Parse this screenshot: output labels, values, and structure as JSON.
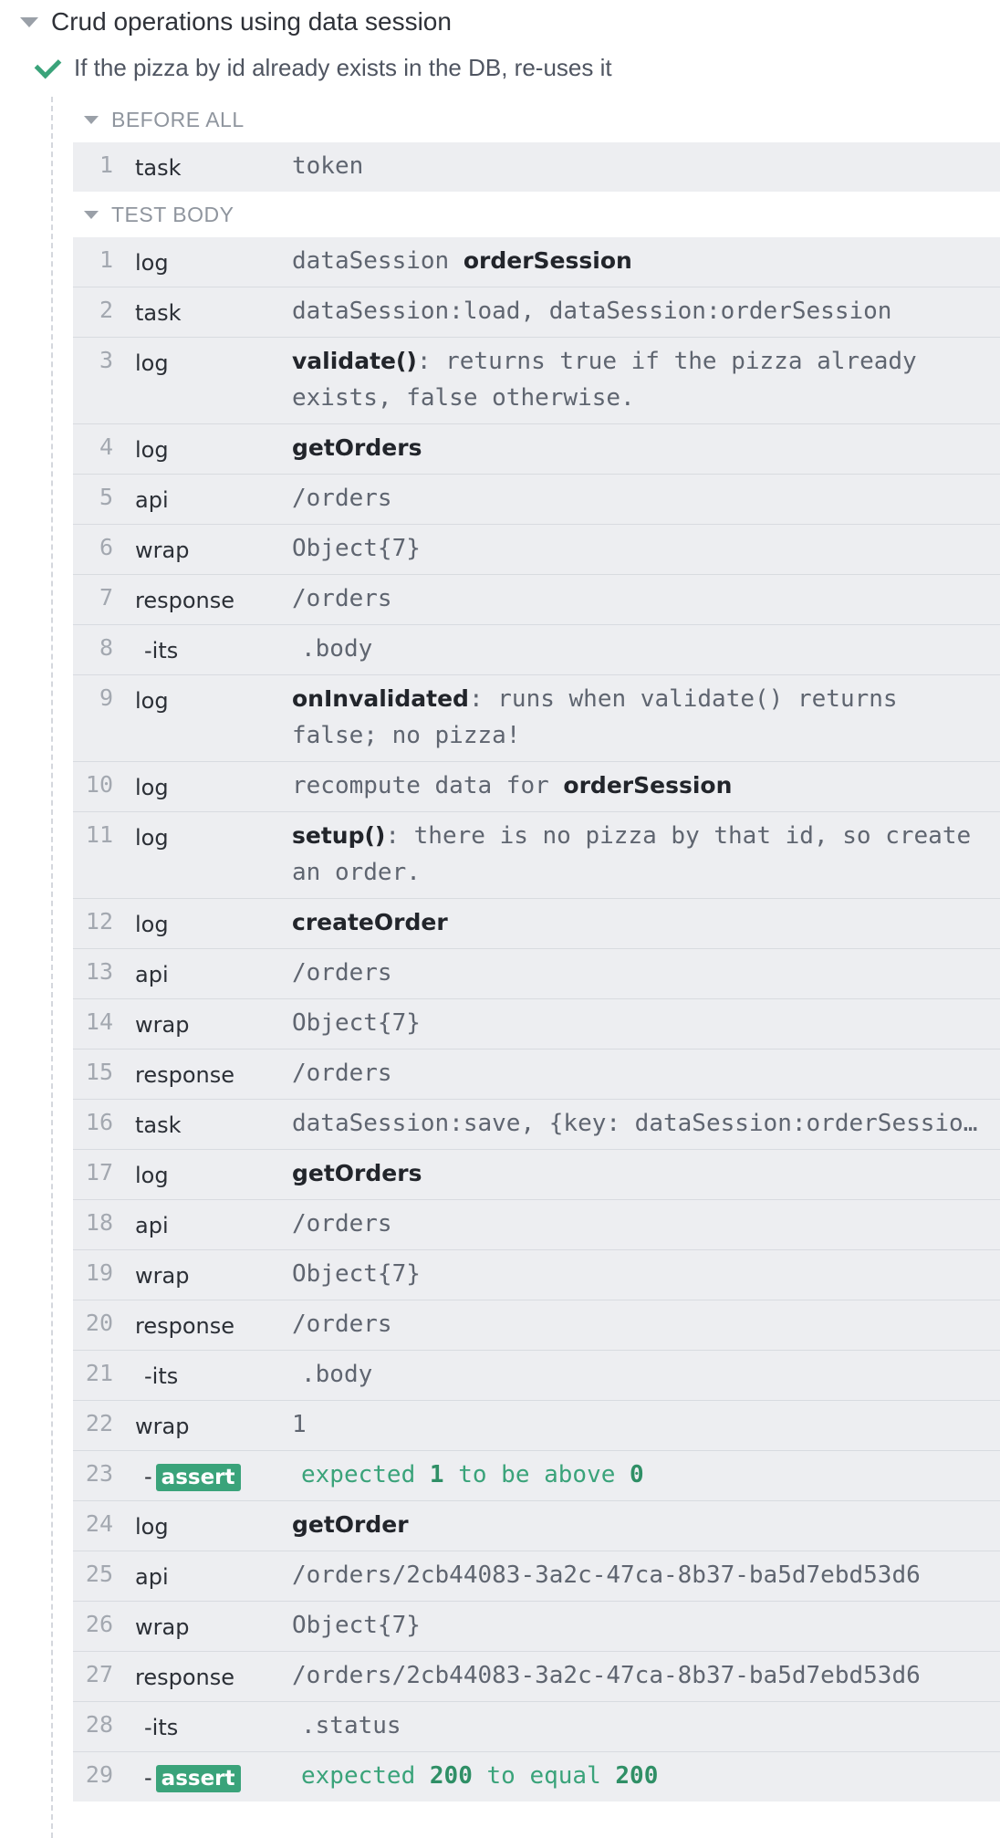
{
  "suite": {
    "title": "Crud operations using data session"
  },
  "test": {
    "title": "If the pizza by id already exists in the DB, re-uses it"
  },
  "before_all": {
    "label": "BEFORE ALL",
    "commands": [
      {
        "num": "1",
        "name": "task",
        "message": "token"
      }
    ]
  },
  "test_body": {
    "label": "TEST BODY",
    "commands": [
      {
        "num": "1",
        "name": "log",
        "message": "dataSession ",
        "bold": "orderSession"
      },
      {
        "num": "2",
        "name": "task",
        "message": "dataSession:load, dataSession:orderSession"
      },
      {
        "num": "3",
        "name": "log",
        "bold_prefix": "validate()",
        "message": ": returns true if the pizza already exists, false otherwise."
      },
      {
        "num": "4",
        "name": "log",
        "bold_prefix": "getOrders"
      },
      {
        "num": "5",
        "name": "api",
        "message": "/orders"
      },
      {
        "num": "6",
        "name": "wrap",
        "message": "Object{7}"
      },
      {
        "num": "7",
        "name": "response",
        "message": "/orders"
      },
      {
        "num": "8",
        "name": "-its",
        "child": true,
        "message": ".body"
      },
      {
        "num": "9",
        "name": "log",
        "bold_prefix": "onInvalidated",
        "message": ": runs when validate() returns false; no pizza!"
      },
      {
        "num": "10",
        "name": "log",
        "message": "recompute data for ",
        "bold": "orderSession"
      },
      {
        "num": "11",
        "name": "log",
        "bold_prefix": "setup()",
        "message": ": there is no pizza by that id, so create an order."
      },
      {
        "num": "12",
        "name": "log",
        "bold_prefix": "createOrder"
      },
      {
        "num": "13",
        "name": "api",
        "message": "/orders"
      },
      {
        "num": "14",
        "name": "wrap",
        "message": "Object{7}"
      },
      {
        "num": "15",
        "name": "response",
        "message": "/orders"
      },
      {
        "num": "16",
        "name": "task",
        "message": "dataSession:save, {key: dataSession:orderSessio…"
      },
      {
        "num": "17",
        "name": "log",
        "bold_prefix": "getOrders"
      },
      {
        "num": "18",
        "name": "api",
        "message": "/orders"
      },
      {
        "num": "19",
        "name": "wrap",
        "message": "Object{7}"
      },
      {
        "num": "20",
        "name": "response",
        "message": "/orders"
      },
      {
        "num": "21",
        "name": "-its",
        "child": true,
        "message": ".body"
      },
      {
        "num": "22",
        "name": "wrap",
        "message": "1"
      },
      {
        "num": "23",
        "name": "-",
        "assert": "assert",
        "child": true,
        "assert_parts": [
          "expected",
          "1",
          "to be above",
          "0"
        ]
      },
      {
        "num": "24",
        "name": "log",
        "bold_prefix": "getOrder"
      },
      {
        "num": "25",
        "name": "api",
        "message": "/orders/2cb44083-3a2c-47ca-8b37-ba5d7ebd53d6"
      },
      {
        "num": "26",
        "name": "wrap",
        "message": "Object{7}"
      },
      {
        "num": "27",
        "name": "response",
        "message": "/orders/2cb44083-3a2c-47ca-8b37-ba5d7ebd53d6"
      },
      {
        "num": "28",
        "name": "-its",
        "child": true,
        "message": ".status"
      },
      {
        "num": "29",
        "name": "-",
        "assert": "assert",
        "child": true,
        "assert_parts": [
          "expected",
          "200",
          "to equal",
          "200"
        ]
      }
    ]
  }
}
